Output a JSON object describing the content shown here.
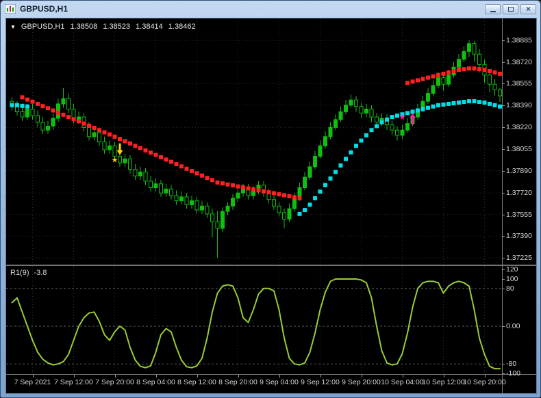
{
  "window": {
    "title": "GBPUSD,H1",
    "close_glyph": "×"
  },
  "ohlc_bar": {
    "dropdown": "▼",
    "symbol": "GBPUSD,H1",
    "open": "1.38508",
    "high": "1.38523",
    "low": "1.38414",
    "close": "1.38462"
  },
  "indicator_label": {
    "name": "R1(9)",
    "value": "-3.8"
  },
  "colors": {
    "pane_background": "#000000",
    "candle_green": "#10C010",
    "dot_red": "#FF2020",
    "dot_cyan": "#00E0E8",
    "oscillator_green": "#9ACD32",
    "grid": "#2E2E2E",
    "marker_yellow": "#FFD700",
    "marker_magenta": "#FF1E9E",
    "scale_text": "#D8D8D8",
    "separator": "#7A7A7A"
  },
  "chart_data": {
    "type": "candlestick",
    "symbol": "GBPUSD",
    "timeframe": "H1",
    "price_axis_range": [
      1.37225,
      1.38885
    ],
    "price_scale": [
      "1.38885",
      "1.38720",
      "1.38555",
      "1.38390",
      "1.38220",
      "1.38055",
      "1.37890",
      "1.37720",
      "1.37555",
      "1.37390",
      "1.37225"
    ],
    "time_labels": [
      {
        "text": "7 Sep 2021",
        "index": 4
      },
      {
        "text": "7 Sep 12:00",
        "index": 12
      },
      {
        "text": "7 Sep 20:00",
        "index": 20
      },
      {
        "text": "8 Sep 04:00",
        "index": 28
      },
      {
        "text": "8 Sep 12:00",
        "index": 36
      },
      {
        "text": "8 Sep 20:00",
        "index": 44
      },
      {
        "text": "9 Sep 04:00",
        "index": 52
      },
      {
        "text": "9 Sep 12:00",
        "index": 60
      },
      {
        "text": "9 Sep 20:00",
        "index": 68
      },
      {
        "text": "10 Sep 04:00",
        "index": 76
      },
      {
        "text": "10 Sep 12:00",
        "index": 84
      },
      {
        "text": "10 Sep 20:00",
        "index": 92
      }
    ],
    "candles": [
      [
        1.3842,
        1.3845,
        1.3835,
        1.3838
      ],
      [
        1.3838,
        1.3842,
        1.3831,
        1.3834
      ],
      [
        1.3834,
        1.3838,
        1.3827,
        1.383
      ],
      [
        1.383,
        1.384,
        1.3828,
        1.3836
      ],
      [
        1.3836,
        1.384,
        1.3828,
        1.3831
      ],
      [
        1.3831,
        1.3835,
        1.3822,
        1.3826
      ],
      [
        1.3826,
        1.383,
        1.3817,
        1.382
      ],
      [
        1.382,
        1.3827,
        1.3817,
        1.3823
      ],
      [
        1.3823,
        1.3833,
        1.382,
        1.3829
      ],
      [
        1.3829,
        1.3844,
        1.3826,
        1.384
      ],
      [
        1.384,
        1.3852,
        1.3837,
        1.3844
      ],
      [
        1.3844,
        1.3848,
        1.3833,
        1.3836
      ],
      [
        1.3836,
        1.384,
        1.3825,
        1.3828
      ],
      [
        1.3828,
        1.3834,
        1.3825,
        1.383
      ],
      [
        1.383,
        1.3833,
        1.3819,
        1.3822
      ],
      [
        1.3822,
        1.3826,
        1.3812,
        1.3815
      ],
      [
        1.3815,
        1.3822,
        1.3812,
        1.3818
      ],
      [
        1.3818,
        1.3821,
        1.3808,
        1.3811
      ],
      [
        1.3811,
        1.3815,
        1.3802,
        1.3805
      ],
      [
        1.3805,
        1.3812,
        1.3802,
        1.3808
      ],
      [
        1.3808,
        1.3811,
        1.3797,
        1.38
      ],
      [
        1.38,
        1.3804,
        1.3792,
        1.3795
      ],
      [
        1.3795,
        1.3802,
        1.3792,
        1.3798
      ],
      [
        1.3798,
        1.3801,
        1.3787,
        1.379
      ],
      [
        1.379,
        1.3794,
        1.3782,
        1.3785
      ],
      [
        1.3785,
        1.3792,
        1.3782,
        1.3788
      ],
      [
        1.3788,
        1.3791,
        1.3778,
        1.3781
      ],
      [
        1.3781,
        1.3785,
        1.3773,
        1.3776
      ],
      [
        1.3776,
        1.3783,
        1.3773,
        1.3779
      ],
      [
        1.3779,
        1.3782,
        1.3769,
        1.3772
      ],
      [
        1.3772,
        1.3779,
        1.3769,
        1.3775
      ],
      [
        1.3775,
        1.3778,
        1.3767,
        1.377
      ],
      [
        1.377,
        1.3774,
        1.3763,
        1.3766
      ],
      [
        1.3766,
        1.3773,
        1.3763,
        1.3769
      ],
      [
        1.3769,
        1.3772,
        1.376,
        1.3763
      ],
      [
        1.3763,
        1.377,
        1.376,
        1.3766
      ],
      [
        1.3766,
        1.3769,
        1.3756,
        1.3759
      ],
      [
        1.3759,
        1.3766,
        1.3756,
        1.3762
      ],
      [
        1.3762,
        1.3765,
        1.3753,
        1.3756
      ],
      [
        1.3756,
        1.376,
        1.3738,
        1.375
      ],
      [
        1.375,
        1.3758,
        1.37225,
        1.3745
      ],
      [
        1.3745,
        1.3761,
        1.3742,
        1.3758
      ],
      [
        1.3758,
        1.3765,
        1.3755,
        1.3762
      ],
      [
        1.3762,
        1.3771,
        1.3759,
        1.3768
      ],
      [
        1.3768,
        1.3775,
        1.3765,
        1.3772
      ],
      [
        1.3772,
        1.3779,
        1.3769,
        1.3776
      ],
      [
        1.3776,
        1.3779,
        1.3767,
        1.377
      ],
      [
        1.377,
        1.3777,
        1.3767,
        1.3774
      ],
      [
        1.3774,
        1.3781,
        1.3771,
        1.3778
      ],
      [
        1.3778,
        1.3781,
        1.3769,
        1.3772
      ],
      [
        1.3772,
        1.3775,
        1.3764,
        1.3767
      ],
      [
        1.3767,
        1.377,
        1.3759,
        1.3762
      ],
      [
        1.3762,
        1.3765,
        1.3754,
        1.3757
      ],
      [
        1.3757,
        1.376,
        1.3745,
        1.3752
      ],
      [
        1.3752,
        1.3764,
        1.375,
        1.376
      ],
      [
        1.376,
        1.3772,
        1.3758,
        1.3768
      ],
      [
        1.3768,
        1.378,
        1.3766,
        1.3776
      ],
      [
        1.3776,
        1.3788,
        1.3774,
        1.3784
      ],
      [
        1.3784,
        1.3796,
        1.3782,
        1.3792
      ],
      [
        1.3792,
        1.3804,
        1.379,
        1.38
      ],
      [
        1.38,
        1.3812,
        1.3798,
        1.3808
      ],
      [
        1.3808,
        1.3819,
        1.3806,
        1.3815
      ],
      [
        1.3815,
        1.3826,
        1.3813,
        1.3822
      ],
      [
        1.3822,
        1.3832,
        1.382,
        1.3828
      ],
      [
        1.3828,
        1.3838,
        1.3826,
        1.3834
      ],
      [
        1.3834,
        1.3843,
        1.3832,
        1.3839
      ],
      [
        1.3839,
        1.3847,
        1.3837,
        1.3843
      ],
      [
        1.3843,
        1.3846,
        1.3834,
        1.3838
      ],
      [
        1.3838,
        1.3841,
        1.3829,
        1.3833
      ],
      [
        1.3833,
        1.384,
        1.383,
        1.3836
      ],
      [
        1.3836,
        1.3839,
        1.3826,
        1.383
      ],
      [
        1.383,
        1.3833,
        1.3822,
        1.3826
      ],
      [
        1.3826,
        1.3833,
        1.3823,
        1.3829
      ],
      [
        1.3829,
        1.3832,
        1.382,
        1.3824
      ],
      [
        1.3824,
        1.3827,
        1.3816,
        1.382
      ],
      [
        1.382,
        1.3823,
        1.3812,
        1.3816
      ],
      [
        1.3816,
        1.3824,
        1.3813,
        1.382
      ],
      [
        1.382,
        1.3829,
        1.3818,
        1.3825
      ],
      [
        1.3825,
        1.3834,
        1.3823,
        1.383
      ],
      [
        1.383,
        1.384,
        1.3828,
        1.3836
      ],
      [
        1.3836,
        1.3846,
        1.3834,
        1.3842
      ],
      [
        1.3842,
        1.3852,
        1.384,
        1.3848
      ],
      [
        1.3848,
        1.3858,
        1.3846,
        1.3854
      ],
      [
        1.3854,
        1.3864,
        1.3852,
        1.386
      ],
      [
        1.386,
        1.3863,
        1.385,
        1.3855
      ],
      [
        1.3855,
        1.3866,
        1.3853,
        1.3862
      ],
      [
        1.3862,
        1.3872,
        1.386,
        1.3868
      ],
      [
        1.3868,
        1.3878,
        1.3866,
        1.3874
      ],
      [
        1.3874,
        1.3884,
        1.3872,
        1.388
      ],
      [
        1.388,
        1.38885,
        1.3876,
        1.3886
      ],
      [
        1.3886,
        1.3888,
        1.3872,
        1.3878
      ],
      [
        1.3878,
        1.3882,
        1.3864,
        1.387
      ],
      [
        1.387,
        1.3874,
        1.3856,
        1.3862
      ],
      [
        1.3862,
        1.3866,
        1.3849,
        1.3855
      ],
      [
        1.3855,
        1.3859,
        1.3846,
        1.38508
      ],
      [
        1.38508,
        1.38523,
        1.38414,
        1.38462
      ]
    ],
    "dots_red": [
      [
        2,
        1.3845
      ],
      [
        3,
        1.38433
      ],
      [
        4,
        1.38417
      ],
      [
        5,
        1.384
      ],
      [
        6,
        1.38383
      ],
      [
        7,
        1.38367
      ],
      [
        8,
        1.3835
      ],
      [
        9,
        1.38333
      ],
      [
        10,
        1.38317
      ],
      [
        11,
        1.383
      ],
      [
        12,
        1.38283
      ],
      [
        13,
        1.38267
      ],
      [
        14,
        1.3825
      ],
      [
        15,
        1.38233
      ],
      [
        16,
        1.38217
      ],
      [
        17,
        1.382
      ],
      [
        18,
        1.38183
      ],
      [
        19,
        1.38167
      ],
      [
        20,
        1.3815
      ],
      [
        21,
        1.38133
      ],
      [
        22,
        1.38115
      ],
      [
        23,
        1.38098
      ],
      [
        24,
        1.3808
      ],
      [
        25,
        1.38063
      ],
      [
        26,
        1.38045
      ],
      [
        27,
        1.38028
      ],
      [
        28,
        1.3801
      ],
      [
        29,
        1.37993
      ],
      [
        30,
        1.37975
      ],
      [
        31,
        1.37958
      ],
      [
        32,
        1.3794
      ],
      [
        33,
        1.37923
      ],
      [
        34,
        1.37905
      ],
      [
        35,
        1.37888
      ],
      [
        36,
        1.3787
      ],
      [
        37,
        1.37853
      ],
      [
        38,
        1.37835
      ],
      [
        39,
        1.37818
      ],
      [
        40,
        1.378
      ],
      [
        41,
        1.37793
      ],
      [
        42,
        1.37785
      ],
      [
        43,
        1.37778
      ],
      [
        44,
        1.3777
      ],
      [
        45,
        1.37763
      ],
      [
        46,
        1.37755
      ],
      [
        47,
        1.37748
      ],
      [
        48,
        1.3774
      ],
      [
        49,
        1.37733
      ],
      [
        50,
        1.37725
      ],
      [
        51,
        1.37718
      ],
      [
        52,
        1.3771
      ],
      [
        53,
        1.37703
      ],
      [
        54,
        1.37695
      ],
      [
        55,
        1.37688
      ],
      [
        56,
        1.3768
      ],
      [
        77,
        1.3856
      ],
      [
        78,
        1.3857
      ],
      [
        79,
        1.3858
      ],
      [
        80,
        1.3859
      ],
      [
        81,
        1.386
      ],
      [
        82,
        1.3861
      ],
      [
        83,
        1.3862
      ],
      [
        84,
        1.3863
      ],
      [
        85,
        1.3864
      ],
      [
        86,
        1.3865
      ],
      [
        87,
        1.3866
      ],
      [
        88,
        1.38665
      ],
      [
        89,
        1.3867
      ],
      [
        90,
        1.3867
      ],
      [
        91,
        1.38665
      ],
      [
        92,
        1.3866
      ],
      [
        93,
        1.3865
      ],
      [
        94,
        1.3864
      ],
      [
        95,
        1.3863
      ]
    ],
    "dots_cyan": [
      [
        0,
        1.3839
      ],
      [
        1,
        1.3839
      ],
      [
        2,
        1.38385
      ],
      [
        3,
        1.3838
      ],
      [
        56,
        1.3756
      ],
      [
        57,
        1.3759
      ],
      [
        58,
        1.3763
      ],
      [
        59,
        1.3768
      ],
      [
        60,
        1.3773
      ],
      [
        61,
        1.3778
      ],
      [
        62,
        1.3783
      ],
      [
        63,
        1.3788
      ],
      [
        64,
        1.3793
      ],
      [
        65,
        1.3798
      ],
      [
        66,
        1.3803
      ],
      [
        67,
        1.3808
      ],
      [
        68,
        1.3812
      ],
      [
        69,
        1.3816
      ],
      [
        70,
        1.382
      ],
      [
        71,
        1.3823
      ],
      [
        72,
        1.3826
      ],
      [
        73,
        1.3828
      ],
      [
        74,
        1.383
      ],
      [
        75,
        1.3831
      ],
      [
        76,
        1.3832
      ],
      [
        77,
        1.3833
      ],
      [
        78,
        1.3834
      ],
      [
        79,
        1.3835
      ],
      [
        80,
        1.3836
      ],
      [
        81,
        1.3837
      ],
      [
        82,
        1.3838
      ],
      [
        83,
        1.3839
      ],
      [
        84,
        1.38395
      ],
      [
        85,
        1.384
      ],
      [
        86,
        1.38405
      ],
      [
        87,
        1.3841
      ],
      [
        88,
        1.38415
      ],
      [
        89,
        1.3842
      ],
      [
        90,
        1.3842
      ],
      [
        91,
        1.38415
      ],
      [
        92,
        1.3841
      ],
      [
        93,
        1.384
      ],
      [
        94,
        1.3839
      ],
      [
        95,
        1.3838
      ]
    ],
    "markers": [
      {
        "shape": "arrow_down",
        "name": "sell-arrow",
        "color": "#FFD700",
        "index": 21,
        "price": 1.3801
      },
      {
        "shape": "star",
        "name": "sell-star",
        "color": "#FFD700",
        "index": 20,
        "price": 1.37975
      },
      {
        "shape": "arrow_up",
        "name": "buy-arrow",
        "color": "#FF1E9E",
        "index": 78,
        "price": 1.3833
      },
      {
        "shape": "star",
        "name": "buy-star",
        "color": "#FF1E9E",
        "index": 76,
        "price": 1.383
      }
    ],
    "oscillator": {
      "name": "R1(9)",
      "value_label": "-3.8",
      "range": [
        -100,
        120
      ],
      "levels": [
        80,
        0,
        -80
      ],
      "scale_labels": [
        {
          "text": "120",
          "value": 120
        },
        {
          "text": "100",
          "value": 100
        },
        {
          "text": "80",
          "value": 80
        },
        {
          "text": "0.00",
          "value": 0
        },
        {
          "text": "-80",
          "value": -80
        },
        {
          "text": "-100",
          "value": -100
        }
      ],
      "values": [
        50,
        60,
        30,
        0,
        -30,
        -55,
        -70,
        -78,
        -82,
        -80,
        -75,
        -60,
        -30,
        0,
        18,
        28,
        30,
        10,
        -18,
        -30,
        -12,
        0,
        -8,
        -45,
        -72,
        -85,
        -88,
        -84,
        -55,
        -18,
        -5,
        -12,
        -45,
        -72,
        -86,
        -88,
        -84,
        -68,
        -25,
        30,
        70,
        85,
        88,
        85,
        60,
        18,
        8,
        35,
        68,
        80,
        80,
        75,
        35,
        -25,
        -68,
        -80,
        -82,
        -78,
        -55,
        -15,
        35,
        72,
        95,
        100,
        100,
        100,
        100,
        100,
        98,
        92,
        60,
        0,
        -52,
        -78,
        -82,
        -80,
        -58,
        -15,
        40,
        80,
        92,
        95,
        95,
        92,
        70,
        85,
        92,
        95,
        92,
        85,
        35,
        -25,
        -60,
        -85,
        -90,
        -90
      ]
    }
  }
}
